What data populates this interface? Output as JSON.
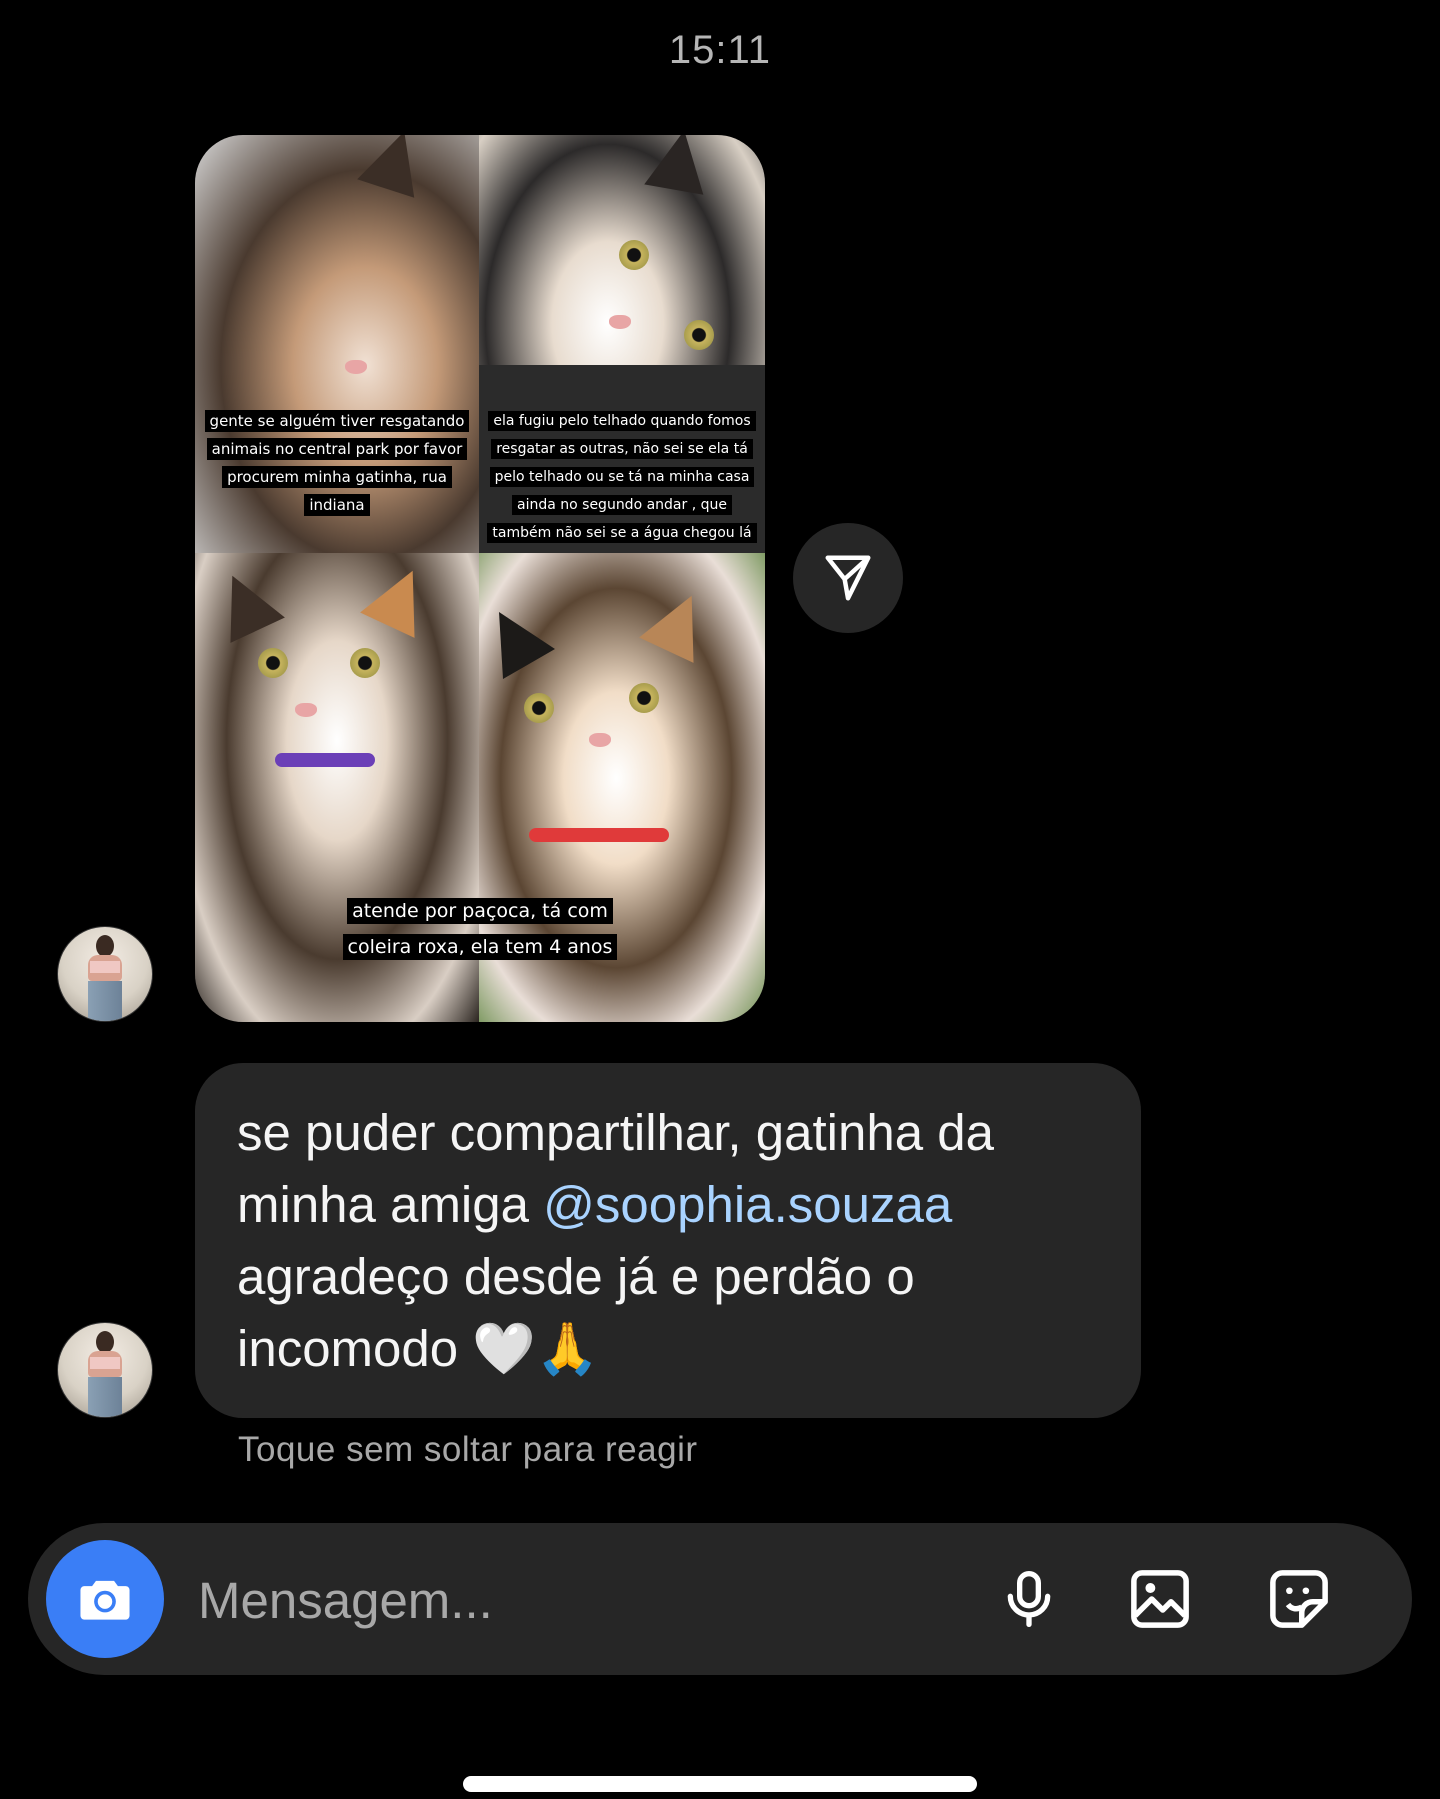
{
  "status": {
    "time": "15:11"
  },
  "story_reply": {
    "captions": [
      "gente se alguém tiver resgatando animais no central park por favor procurem minha gatinha, rua indiana",
      "ela fugiu pelo telhado quando fomos resgatar as outras, não sei se ela tá pelo telhado ou se tá na minha casa ainda no segundo andar , que também não sei se a água chegou lá",
      "atende por paçoca, tá com coleira roxa, ela tem 4 anos"
    ],
    "share_icon": "paper-plane-icon"
  },
  "message": {
    "text_before": "se puder compartilhar, gatinha da minha amiga ",
    "mention": "@soophia.souzaa",
    "text_after": "\nagradeço desde já e perdão o incomodo 🤍🙏",
    "hint": "Toque sem soltar para reagir"
  },
  "composer": {
    "placeholder": "Mensagem...",
    "camera_icon": "camera-icon",
    "mic_icon": "microphone-icon",
    "gallery_icon": "image-icon",
    "sticker_icon": "sticker-icon"
  },
  "colors": {
    "background": "#000000",
    "bubble": "#262626",
    "camera_button": "#3a7ef6",
    "mention": "#a9d3ff",
    "muted_text": "#a8a8a8"
  }
}
